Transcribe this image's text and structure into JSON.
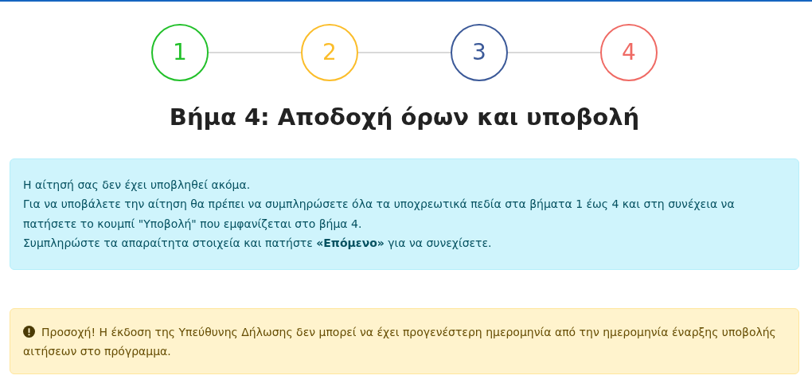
{
  "steps": [
    {
      "label": "1",
      "color": "#22c02a"
    },
    {
      "label": "2",
      "color": "#fbbd2a"
    },
    {
      "label": "3",
      "color": "#3b5998"
    },
    {
      "label": "4",
      "color": "#ef6a64"
    }
  ],
  "title": "Βήμα 4: Αποδοχή όρων και υποβολή",
  "info_lines": [
    "Η αίτησή σας δεν έχει υποβληθεί ακόμα.",
    "Για να υποβάλετε την αίτηση θα πρέπει να συμπληρώσετε όλα τα υποχρεωτικά πεδία στα βήματα 1 έως 4 και στη συνέχεια να πατήσετε το κουμπί \"Υποβολή\" που εμφανίζεται στο βήμα 4.",
    "Συμπληρώστε τα απαραίτητα στοιχεία και πατήστε **«Επόμενο»** για να συνεχίσετε."
  ],
  "warning": "Προσοχή! Η έκδοση της Υπεύθυνης Δήλωσης δεν μπορεί να έχει προγενέστερη ημερομηνία από την ημερομηνία έναρξης υποβολής αιτήσεων στο πρόγραμμα."
}
